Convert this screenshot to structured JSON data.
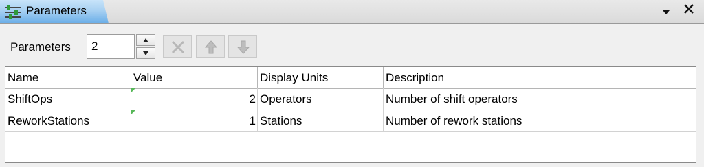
{
  "panel": {
    "tab_title": "Parameters",
    "tab_icon": "sliders-icon",
    "menu_icon": "dropdown-arrow-icon",
    "close_icon": "close-icon"
  },
  "toolbar": {
    "label": "Parameters",
    "count_value": "2",
    "delete_icon": "delete-x-icon",
    "move_up_icon": "arrow-up-icon",
    "move_down_icon": "arrow-down-icon"
  },
  "table": {
    "columns": [
      "Name",
      "Value",
      "Display Units",
      "Description"
    ],
    "rows": [
      {
        "name": "ShiftOps",
        "value": "2",
        "units": "Operators",
        "description": "Number of shift operators"
      },
      {
        "name": "ReworkStations",
        "value": "1",
        "units": "Stations",
        "description": "Number of rework stations"
      }
    ]
  },
  "colors": {
    "tab_accent": "#6aaee8",
    "value_marker": "#58b85a"
  }
}
